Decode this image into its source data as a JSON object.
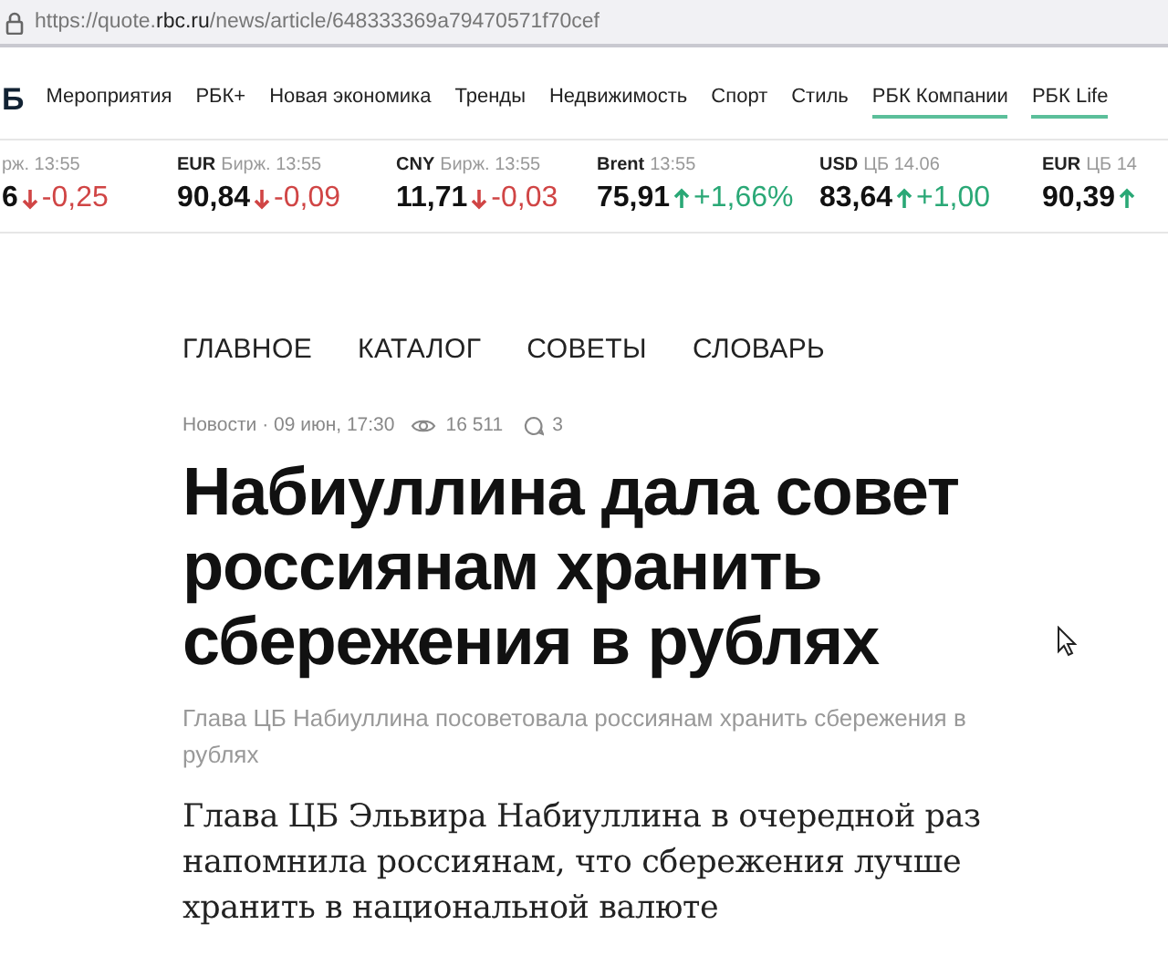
{
  "address_bar": {
    "url_prefix": "https://quote.",
    "url_domain": "rbc.ru",
    "url_path": "/news/article/648333369a79470571f70cef"
  },
  "top_nav": {
    "logo": "Б",
    "items": [
      {
        "label": "Мероприятия",
        "underlined": false
      },
      {
        "label": "РБК+",
        "underlined": false
      },
      {
        "label": "Новая экономика",
        "underlined": false
      },
      {
        "label": "Тренды",
        "underlined": false
      },
      {
        "label": "Недвижимость",
        "underlined": false
      },
      {
        "label": "Спорт",
        "underlined": false
      },
      {
        "label": "Стиль",
        "underlined": false
      },
      {
        "label": "РБК Компании",
        "underlined": true
      },
      {
        "label": "РБК Life",
        "underlined": true
      }
    ]
  },
  "ticker": [
    {
      "source": "рж. 13:55",
      "value": "6",
      "change": "-0,25",
      "rising": false
    },
    {
      "name": "EUR",
      "source": "Бирж. 13:55",
      "value": "90,84",
      "change": "-0,09",
      "rising": false
    },
    {
      "name": "CNY",
      "source": "Бирж. 13:55",
      "value": "11,71",
      "change": "-0,03",
      "rising": false
    },
    {
      "name": "Brent",
      "source": "13:55",
      "value": "75,91",
      "change": "+1,66%",
      "rising": true
    },
    {
      "name": "USD",
      "source": "ЦБ 14.06",
      "value": "83,64",
      "change": "+1,00",
      "rising": true
    },
    {
      "name": "EUR",
      "source": "ЦБ 14",
      "value": "90,39",
      "rising": true
    }
  ],
  "section_nav": [
    "ГЛАВНОЕ",
    "КАТАЛОГ",
    "СОВЕТЫ",
    "СЛОВАРЬ"
  ],
  "article": {
    "category_date": "Новости · 09 июн, 17:30",
    "views": "16 511",
    "comments": "3",
    "title": "Набиуллина дала совет россиянам хранить сбережения в рублях",
    "subtitle": "Глава ЦБ Набиуллина посоветовала россиянам хранить сбережения в рублях",
    "lead": "Глава ЦБ Эльвира Набиуллина в очередной раз напомнила россиянам, что сбережения лучше хранить в национальной валюте"
  }
}
